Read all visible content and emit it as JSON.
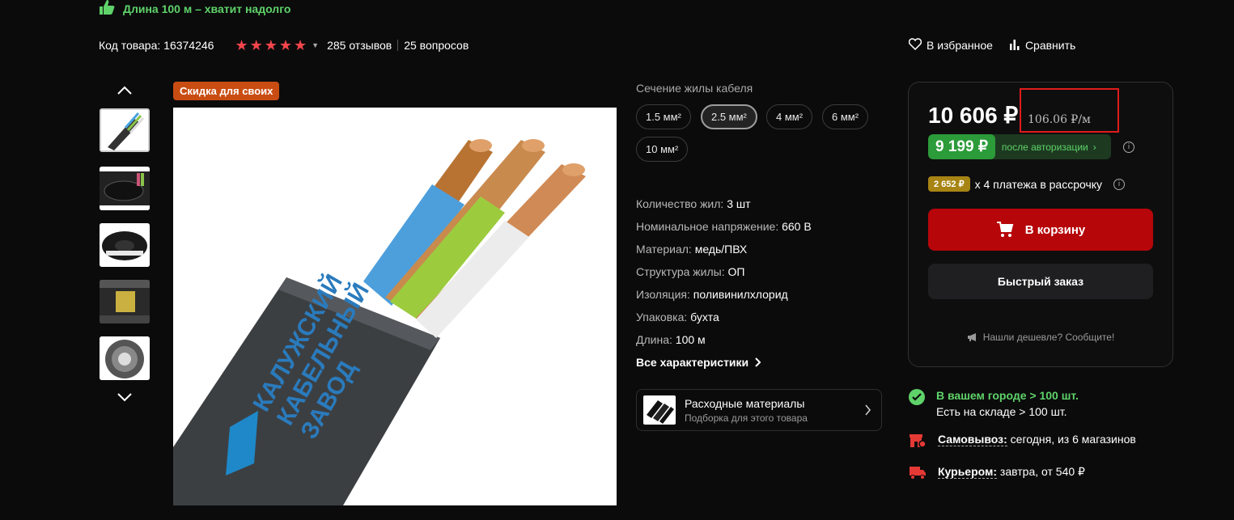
{
  "banner": {
    "text": "Длина 100 м – хватит надолго"
  },
  "product": {
    "code_label": "Код товара:",
    "code": "16374246",
    "reviews": "285 отзывов",
    "questions": "25 вопросов",
    "rating_stars": 5
  },
  "actions": {
    "favorite": "В избранное",
    "compare": "Сравнить"
  },
  "gallery": {
    "badge": "Скидка для своих",
    "logo_lines": [
      "КАЛУЖСКИЙ",
      "КАБЕЛЬНЫЙ",
      "ЗАВОД"
    ]
  },
  "options": {
    "title": "Сечение жилы кабеля",
    "sizes": [
      "1.5 мм²",
      "2.5 мм²",
      "4 мм²",
      "6 мм²",
      "10 мм²"
    ],
    "selected": "2.5 мм²"
  },
  "characteristics": [
    {
      "key": "Количество жил:",
      "value": "3 шт"
    },
    {
      "key": "Номинальное напряжение:",
      "value": "660 В"
    },
    {
      "key": "Материал:",
      "value": "медь/ПВХ"
    },
    {
      "key": "Структура жилы:",
      "value": "ОП"
    },
    {
      "key": "Изоляция:",
      "value": "поливинилхлорид"
    },
    {
      "key": "Упаковка:",
      "value": "бухта"
    },
    {
      "key": "Длина:",
      "value": "100 м"
    }
  ],
  "all_characteristics": "Все характеристики",
  "consumables": {
    "title": "Расходные материалы",
    "subtitle": "Подборка для этого товара"
  },
  "price": {
    "main": "10 606 ₽",
    "per_meter": "106.06 ₽/м",
    "auth_price": "9 199 ₽",
    "auth_label": "после авторизации",
    "installment_amount": "2 652 ₽",
    "installment_text": "х 4 платежа в рассрочку",
    "cart_button": "В корзину",
    "quick_order": "Быстрый заказ",
    "cheaper": "Нашли дешевле? Сообщите!"
  },
  "delivery": {
    "stock_city": "В вашем городе > 100 шт.",
    "stock_warehouse": "Есть на складе > 100 шт.",
    "pickup_label": "Самовывоз:",
    "pickup_text": "сегодня, из 6 магазинов",
    "courier_label": "Курьером:",
    "courier_text": "завтра, от 540 ₽"
  },
  "colors": {
    "accent_red": "#b6060a",
    "green": "#5fd36a",
    "badge_orange": "#c94d12",
    "installment_gold": "#a78413"
  }
}
